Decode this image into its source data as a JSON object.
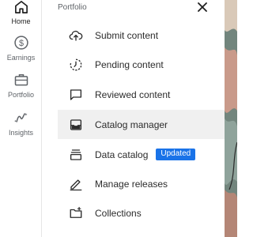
{
  "rail": {
    "items": [
      {
        "label": "Home",
        "icon": "home-icon",
        "active": true
      },
      {
        "label": "Earnings",
        "icon": "dollar-icon",
        "active": false
      },
      {
        "label": "Portfolio",
        "icon": "briefcase-icon",
        "active": false
      },
      {
        "label": "Insights",
        "icon": "insights-icon",
        "active": false
      }
    ]
  },
  "panel": {
    "title": "Portfolio",
    "close_icon": "close-icon",
    "items": [
      {
        "label": "Submit content",
        "icon": "cloud-upload-icon"
      },
      {
        "label": "Pending content",
        "icon": "pending-icon"
      },
      {
        "label": "Reviewed content",
        "icon": "comment-icon"
      },
      {
        "label": "Catalog manager",
        "icon": "inbox-icon",
        "selected": true
      },
      {
        "label": "Data catalog",
        "icon": "stack-icon",
        "badge": "Updated"
      },
      {
        "label": "Manage releases",
        "icon": "pen-icon"
      },
      {
        "label": "Collections",
        "icon": "folder-add-icon"
      }
    ]
  },
  "colors": {
    "badge": "#1a73e8",
    "selected_row": "#f0f0f0",
    "muted_text": "#5f6368"
  }
}
